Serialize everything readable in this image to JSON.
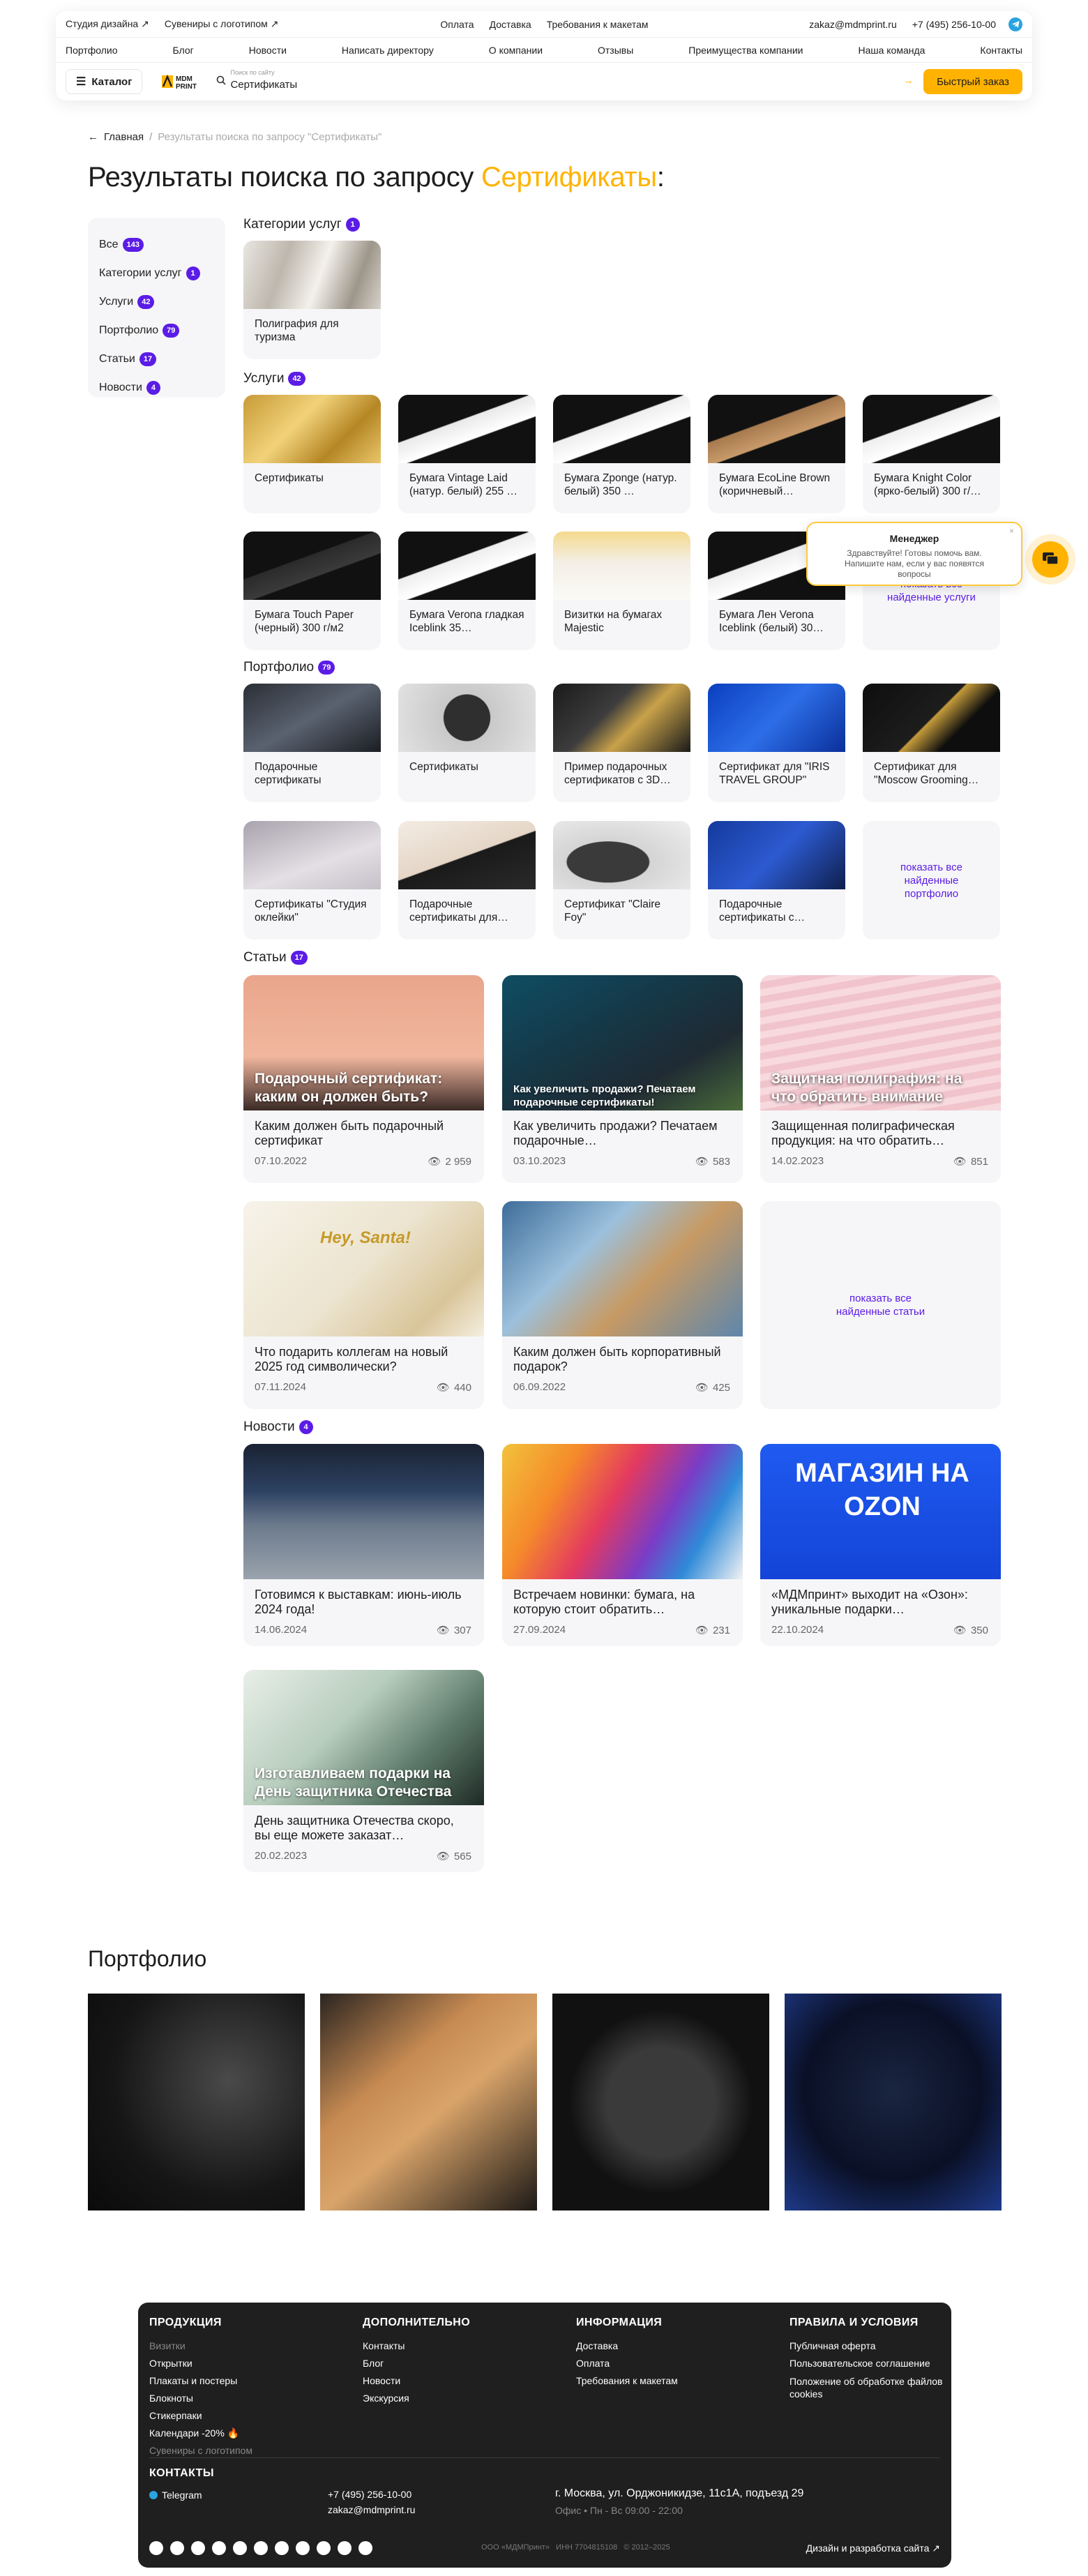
{
  "header": {
    "top_links": [
      "Студия дизайна ↗",
      "Сувениры с логотипом ↗",
      "Оплата",
      "Доставка",
      "Требования к макетам"
    ],
    "email": "zakaz@mdmprint.ru",
    "phone": "+7 (495) 256-10-00",
    "nav": [
      "Портфолио",
      "Блог",
      "Новости",
      "Написать директору",
      "О компании",
      "Отзывы",
      "Преимущества компании",
      "Наша команда",
      "Контакты"
    ],
    "catalog_label": "Каталог",
    "logo_text": "MDM PRINT",
    "search_placeholder": "Поиск по сайту",
    "search_value": "Сертификаты",
    "quick_order": "Быстрый заказ"
  },
  "breadcrumb": {
    "home": "Главная",
    "current": "Результаты поиска по запросу \"Сертификаты\""
  },
  "page_title": {
    "prefix": "Результаты поиска по запросу ",
    "query": "Сертификаты",
    "suffix": ":"
  },
  "sidebar": [
    {
      "label": "Все",
      "count": "143"
    },
    {
      "label": "Категории услуг",
      "count": "1"
    },
    {
      "label": "Услуги",
      "count": "42"
    },
    {
      "label": "Портфолио",
      "count": "79"
    },
    {
      "label": "Статьи",
      "count": "17"
    },
    {
      "label": "Новости",
      "count": "4"
    }
  ],
  "sections": {
    "categories": {
      "title": "Категории услуг",
      "count": "1",
      "items": [
        "Полиграфия для туризма"
      ]
    },
    "services": {
      "title": "Услуги",
      "count": "42",
      "items": [
        "Сертификаты",
        "Бумага Vintage Laid (натур. белый) 255 …",
        "Бумага Zponge (натур. белый) 350 …",
        "Бумага EcoLine Brown (коричневый…",
        "Бумага Knight Color (ярко-белый) 300 г/…",
        "Бумага Touch Paper (черный) 300 г/м2",
        "Бумага Verona гладкая Iceblink 35…",
        "Визитки на бумагах Majestic",
        "Бумага Лен Verona Iceblink (белый) 30…"
      ],
      "more": "показать все найденные услуги"
    },
    "portfolio": {
      "title": "Портфолио",
      "count": "79",
      "items": [
        "Подарочные сертификаты",
        "Сертификаты",
        "Пример подарочных сертификатов с 3D…",
        "Сертификат для \"IRIS TRAVEL GROUP\"",
        "Сертификат для \"Moscow Grooming…",
        "Сертификаты \"Студия оклейки\"",
        "Подарочные сертификаты для…",
        "Сертификат \"Claire Foy\"",
        "Подарочные сертификаты с…"
      ],
      "more": "показать все найденные портфолио"
    },
    "articles": {
      "title": "Статьи",
      "count": "17",
      "items": [
        {
          "overlay": "Подарочный сертификат: каким он должен быть?",
          "title": "Каким должен быть подарочный сертификат",
          "date": "07.10.2022",
          "views": "2 959"
        },
        {
          "overlay": "Как увеличить продажи? Печатаем подарочные сертификаты!",
          "title": "Как увеличить продажи? Печатаем подарочные…",
          "date": "03.10.2023",
          "views": "583"
        },
        {
          "overlay": "Защитная полиграфия: на что обратить внимание",
          "title": "Защищенная полиграфическая продукция: на что обратить…",
          "date": "14.02.2023",
          "views": "851"
        },
        {
          "overlay": "Hey, Santa!",
          "title": "Что подарить коллегам на новый 2025 год символически?",
          "date": "07.11.2024",
          "views": "440"
        },
        {
          "overlay": "",
          "title": "Каким должен быть корпоративный подарок?",
          "date": "06.09.2022",
          "views": "425"
        }
      ],
      "more": "показать все найденные статьи"
    },
    "news": {
      "title": "Новости",
      "count": "4",
      "items": [
        {
          "overlay": "",
          "title": "Готовимся к выставкам: июнь-июль 2024 года!",
          "date": "14.06.2024",
          "views": "307"
        },
        {
          "overlay": "",
          "title": "Встречаем новинки: бумага, на которую стоит обратить…",
          "date": "27.09.2024",
          "views": "231"
        },
        {
          "overlay": "МАГАЗИН НА OZON",
          "title": "«МДМпринт» выходит на «Озон»: уникальные подарки…",
          "date": "22.10.2024",
          "views": "350"
        },
        {
          "overlay": "Изготавливаем подарки на День защитника Отечества",
          "title": "День защитника Отечества скоро, вы еще можете заказат…",
          "date": "20.02.2023",
          "views": "565"
        }
      ]
    }
  },
  "portfolio_block": {
    "title": "Портфолио"
  },
  "chat": {
    "title": "Менеджер",
    "text": "Здравствуйте! Готовы помочь вам. Напишите нам, если у вас появятся вопросы"
  },
  "footer": {
    "cols": [
      {
        "title": "ПРОДУКЦИЯ",
        "links": [
          "Визитки",
          "Открытки",
          "Плакаты и постеры",
          "Блокноты",
          "Стикерпаки",
          "Календари -20% 🔥",
          "Сувениры с логотипом"
        ]
      },
      {
        "title": "ДОПОЛНИТЕЛЬНО",
        "links": [
          "Контакты",
          "Блог",
          "Новости",
          "Экскурсия"
        ]
      },
      {
        "title": "ИНФОРМАЦИЯ",
        "links": [
          "Доставка",
          "Оплата",
          "Требования к макетам"
        ]
      },
      {
        "title": "ПРАВИЛА И УСЛОВИЯ",
        "links": [
          "Публичная оферта",
          "Пользовательское соглашение",
          "Положение об обработке файлов cookies"
        ]
      }
    ],
    "contacts_title": "КОНТАКТЫ",
    "telegram": "Telegram",
    "phone": "+7 (495) 256-10-00",
    "email": "zakaz@mdmprint.ru",
    "address": "г. Москва, ул. Орджоникидзе, 11с1А, подъезд 29",
    "hours": "Офис • Пн - Вс 09:00 - 22:00",
    "legal": "ООО «МДМПринт»   ИНН 7704815108   © 2012–2025",
    "dev": "Дизайн и разработка сайта ↗"
  }
}
